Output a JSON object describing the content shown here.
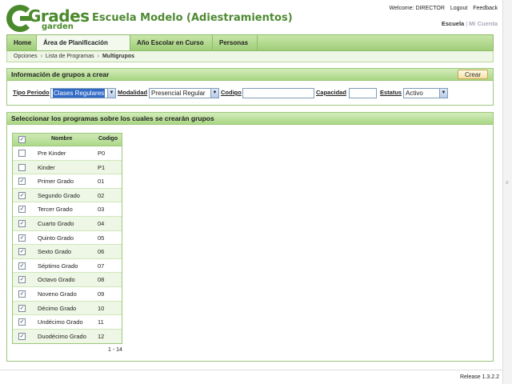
{
  "header": {
    "logo_text": "Grades",
    "logo_sub": "garden",
    "app_title": "Escuela Modelo (Adiestramientos)",
    "welcome": "Welcome: DIRECTOR",
    "logout": "Logout",
    "feedback": "Feedback",
    "escuela_link": "Escuela",
    "cuenta_link": "Mi Cuenta"
  },
  "nav": {
    "tabs": [
      "Home",
      "Área de Planificación",
      "Año Escolar en Curso",
      "Personas"
    ]
  },
  "breadcrumb": [
    "Opciones",
    "Lista de Programas",
    "Multigrupos"
  ],
  "panel_info": {
    "title": "Información de grupos a crear",
    "crear_button": "Crear",
    "tipo_periodo_label": "Tipo Periodo",
    "tipo_periodo_value": "Clases Regulares",
    "modalidad_label": "Modalidad",
    "modalidad_value": "Presencial Regular",
    "codigo_label": "Codigo",
    "capacidad_label": "Capacidad",
    "estatus_label": "Estatus",
    "estatus_value": "Activo"
  },
  "panel_programs": {
    "title": "Seleccionar los programas sobre los cuales se crearán grupos",
    "col_nombre": "Nombre",
    "col_codigo": "Codigo",
    "header_checked": true,
    "rows": [
      {
        "nombre": "Pre Kinder",
        "codigo": "P0",
        "checked": false
      },
      {
        "nombre": "Kinder",
        "codigo": "P1",
        "checked": false
      },
      {
        "nombre": "Primer Grado",
        "codigo": "01",
        "checked": true
      },
      {
        "nombre": "Segundo Grado",
        "codigo": "02",
        "checked": true
      },
      {
        "nombre": "Tercer Grado",
        "codigo": "03",
        "checked": true
      },
      {
        "nombre": "Cuarto Grado",
        "codigo": "04",
        "checked": true
      },
      {
        "nombre": "Quinto Grado",
        "codigo": "05",
        "checked": true
      },
      {
        "nombre": "Sexto Grado",
        "codigo": "06",
        "checked": true
      },
      {
        "nombre": "Séptimo Grado",
        "codigo": "07",
        "checked": true
      },
      {
        "nombre": "Octavo Grado",
        "codigo": "08",
        "checked": true
      },
      {
        "nombre": "Noveno Grado",
        "codigo": "09",
        "checked": true
      },
      {
        "nombre": "Décimo Grado",
        "codigo": "10",
        "checked": true
      },
      {
        "nombre": "Undécimo Grado",
        "codigo": "11",
        "checked": true
      },
      {
        "nombre": "Duodécimo Grado",
        "codigo": "12",
        "checked": true
      }
    ],
    "pager": "1 - 14"
  },
  "footer": {
    "release": "Release 1.3.2.2"
  },
  "colors": {
    "brand_green": "#4a8a2c",
    "title_green": "#4f8a33",
    "selection_blue": "#316ac5"
  }
}
